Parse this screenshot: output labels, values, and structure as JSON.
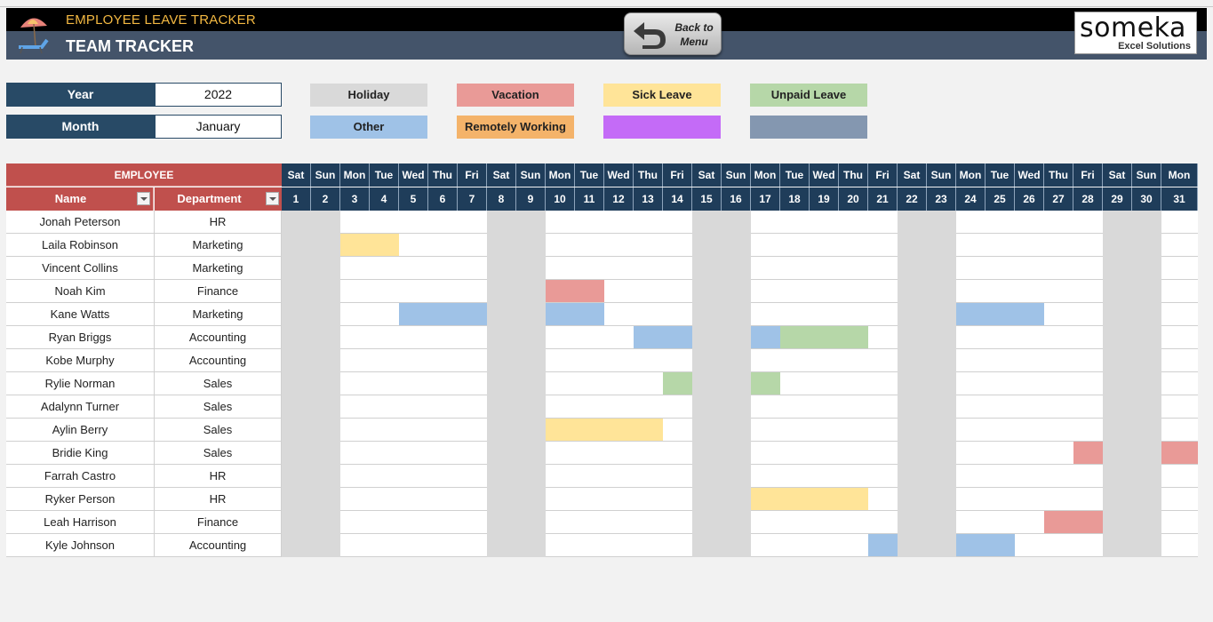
{
  "header": {
    "app_title": "EMPLOYEE LEAVE TRACKER",
    "page_title": "TEAM TRACKER",
    "back_button_label_line1": "Back to",
    "back_button_label_line2": "Menu",
    "brand_name": "someka",
    "brand_sub": "Excel Solutions"
  },
  "filters": {
    "year_label": "Year",
    "year_value": "2022",
    "month_label": "Month",
    "month_value": "January"
  },
  "legend": [
    {
      "key": "holiday",
      "label": "Holiday",
      "color": "#d9d9d9"
    },
    {
      "key": "vacation",
      "label": "Vacation",
      "color": "#e99a97"
    },
    {
      "key": "sick",
      "label": "Sick Leave",
      "color": "#ffe498"
    },
    {
      "key": "unpaid",
      "label": "Unpaid Leave",
      "color": "#b6d7a8"
    },
    {
      "key": "other",
      "label": "Other",
      "color": "#9fc2e7"
    },
    {
      "key": "remote",
      "label": "Remotely Working",
      "color": "#f4b36a"
    },
    {
      "key": "custom1",
      "label": "",
      "color": "#c46bf7"
    },
    {
      "key": "custom2",
      "label": "",
      "color": "#8497b0"
    }
  ],
  "table": {
    "group_header": "EMPLOYEE",
    "name_header": "Name",
    "dept_header": "Department",
    "days": [
      {
        "dow": "Sat",
        "day": "1"
      },
      {
        "dow": "Sun",
        "day": "2"
      },
      {
        "dow": "Mon",
        "day": "3"
      },
      {
        "dow": "Tue",
        "day": "4"
      },
      {
        "dow": "Wed",
        "day": "5"
      },
      {
        "dow": "Thu",
        "day": "6"
      },
      {
        "dow": "Fri",
        "day": "7"
      },
      {
        "dow": "Sat",
        "day": "8"
      },
      {
        "dow": "Sun",
        "day": "9"
      },
      {
        "dow": "Mon",
        "day": "10"
      },
      {
        "dow": "Tue",
        "day": "11"
      },
      {
        "dow": "Wed",
        "day": "12"
      },
      {
        "dow": "Thu",
        "day": "13"
      },
      {
        "dow": "Fri",
        "day": "14"
      },
      {
        "dow": "Sat",
        "day": "15"
      },
      {
        "dow": "Sun",
        "day": "16"
      },
      {
        "dow": "Mon",
        "day": "17"
      },
      {
        "dow": "Tue",
        "day": "18"
      },
      {
        "dow": "Wed",
        "day": "19"
      },
      {
        "dow": "Thu",
        "day": "20"
      },
      {
        "dow": "Fri",
        "day": "21"
      },
      {
        "dow": "Sat",
        "day": "22"
      },
      {
        "dow": "Sun",
        "day": "23"
      },
      {
        "dow": "Mon",
        "day": "24"
      },
      {
        "dow": "Tue",
        "day": "25"
      },
      {
        "dow": "Wed",
        "day": "26"
      },
      {
        "dow": "Thu",
        "day": "27"
      },
      {
        "dow": "Fri",
        "day": "28"
      },
      {
        "dow": "Sat",
        "day": "29"
      },
      {
        "dow": "Sun",
        "day": "30"
      },
      {
        "dow": "Mon",
        "day": "31"
      }
    ],
    "employees": [
      {
        "name": "Jonah Peterson",
        "department": "HR",
        "leaves": {}
      },
      {
        "name": "Laila Robinson",
        "department": "Marketing",
        "leaves": {
          "3": "sick",
          "4": "sick"
        }
      },
      {
        "name": "Vincent Collins",
        "department": "Marketing",
        "leaves": {}
      },
      {
        "name": "Noah Kim",
        "department": "Finance",
        "leaves": {
          "10": "vacation",
          "11": "vacation"
        }
      },
      {
        "name": "Kane Watts",
        "department": "Marketing",
        "leaves": {
          "5": "other",
          "6": "other",
          "7": "other",
          "10": "other",
          "11": "other",
          "24": "other",
          "25": "other",
          "26": "other"
        }
      },
      {
        "name": "Ryan Briggs",
        "department": "Accounting",
        "leaves": {
          "13": "other",
          "14": "other",
          "17": "other",
          "18": "unpaid",
          "19": "unpaid",
          "20": "unpaid"
        }
      },
      {
        "name": "Kobe Murphy",
        "department": "Accounting",
        "leaves": {}
      },
      {
        "name": "Rylie Norman",
        "department": "Sales",
        "leaves": {
          "14": "unpaid",
          "17": "unpaid"
        }
      },
      {
        "name": "Adalynn Turner",
        "department": "Sales",
        "leaves": {}
      },
      {
        "name": "Aylin Berry",
        "department": "Sales",
        "leaves": {
          "10": "sick",
          "11": "sick",
          "12": "sick",
          "13": "sick"
        }
      },
      {
        "name": "Bridie King",
        "department": "Sales",
        "leaves": {
          "28": "vacation",
          "31": "vacation"
        }
      },
      {
        "name": "Farrah Castro",
        "department": "HR",
        "leaves": {}
      },
      {
        "name": "Ryker Person",
        "department": "HR",
        "leaves": {
          "17": "sick",
          "18": "sick",
          "19": "sick",
          "20": "sick"
        }
      },
      {
        "name": "Leah Harrison",
        "department": "Finance",
        "leaves": {
          "27": "vacation",
          "28": "vacation"
        }
      },
      {
        "name": "Kyle Johnson",
        "department": "Accounting",
        "leaves": {
          "21": "other",
          "24": "other",
          "25": "other"
        }
      }
    ]
  }
}
